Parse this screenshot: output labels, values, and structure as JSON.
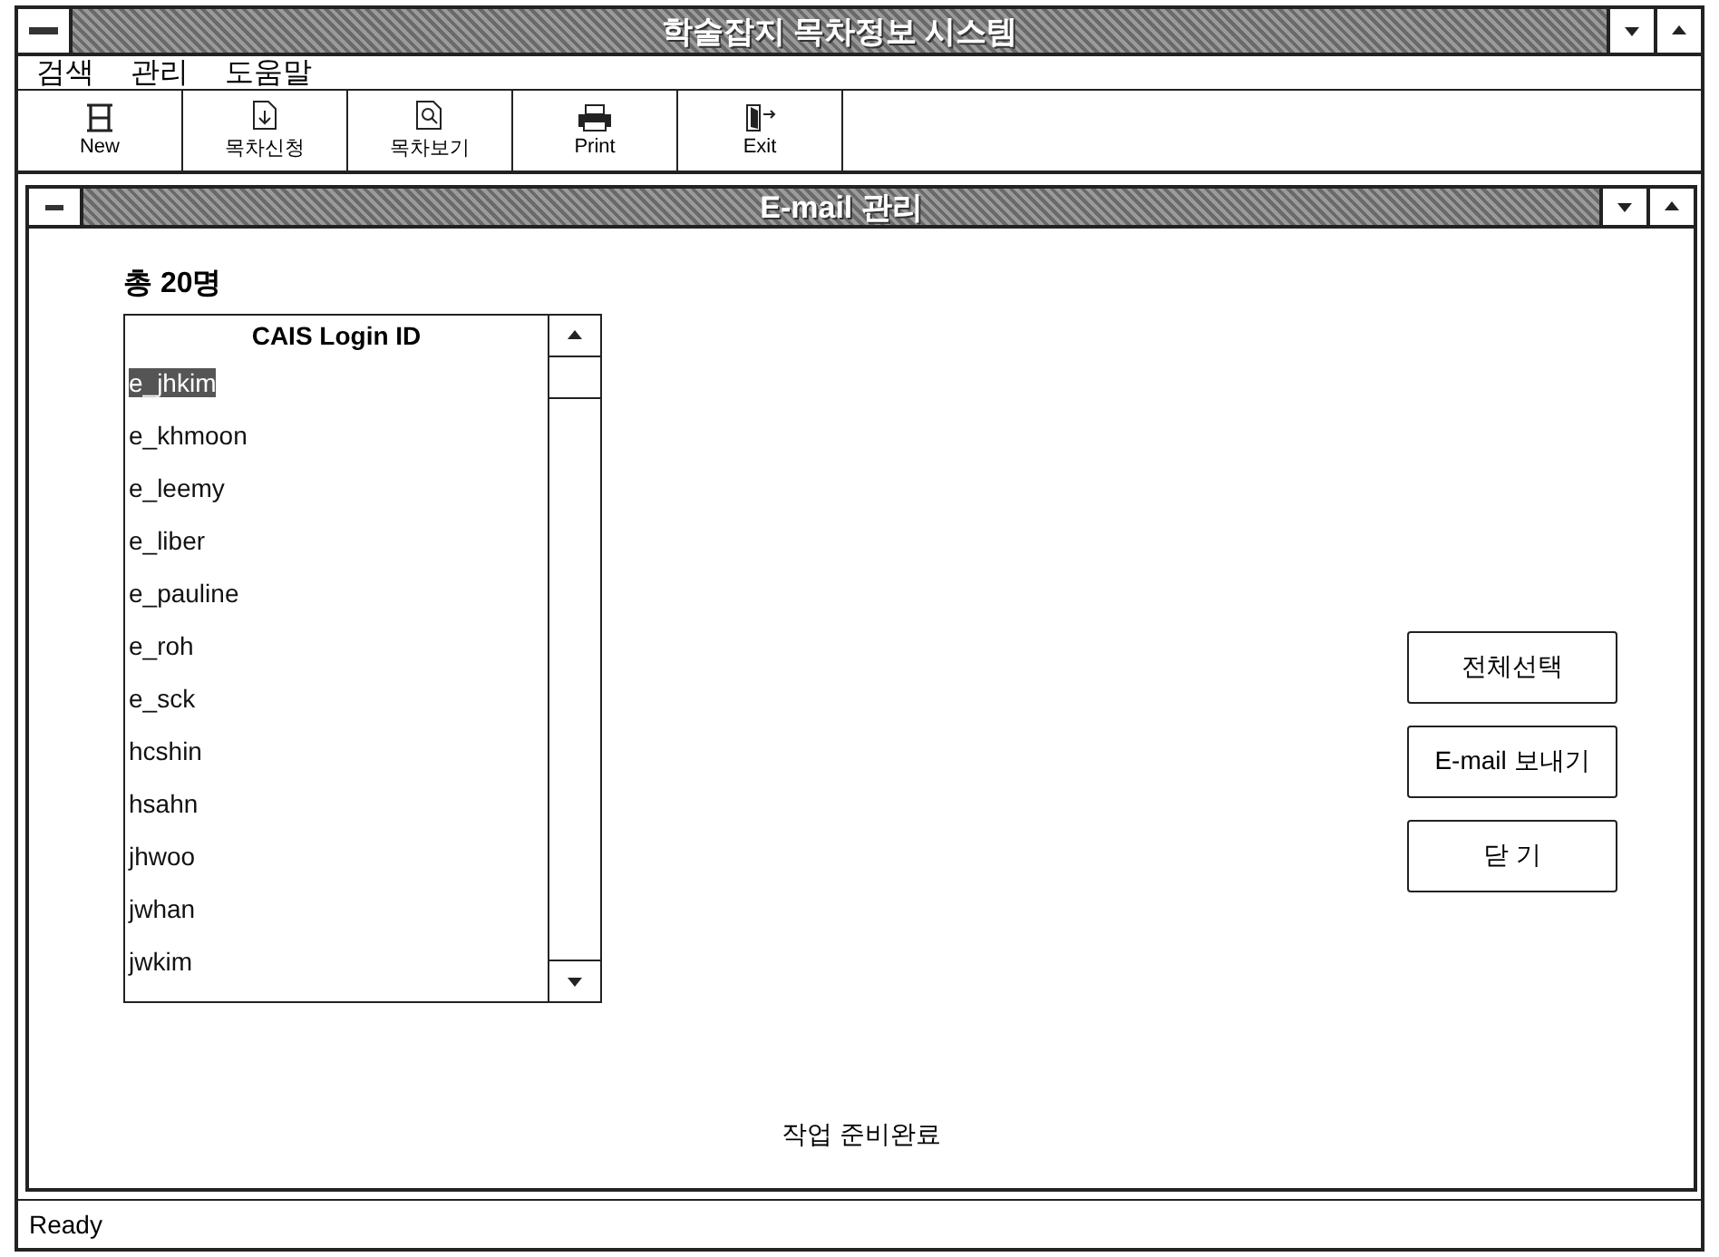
{
  "window": {
    "title": "학술잡지 목차정보 시스템"
  },
  "menu": [
    "검색",
    "관리",
    "도움말"
  ],
  "toolbar": [
    {
      "label": "New",
      "kind": "new"
    },
    {
      "label": "목차신청",
      "kind": "request"
    },
    {
      "label": "목차보기",
      "kind": "view"
    },
    {
      "label": "Print",
      "kind": "print"
    },
    {
      "label": "Exit",
      "kind": "exit"
    }
  ],
  "child_window": {
    "title": "E-mail 관리",
    "count": "총 20명",
    "list": {
      "header": "CAIS Login ID",
      "items": [
        {
          "text": "e_jhkim",
          "selected": true
        },
        {
          "text": "e_khmoon",
          "selected": false
        },
        {
          "text": "e_leemy",
          "selected": false
        },
        {
          "text": "e_liber",
          "selected": false
        },
        {
          "text": "e_pauline",
          "selected": false
        },
        {
          "text": "e_roh",
          "selected": false
        },
        {
          "text": "e_sck",
          "selected": false
        },
        {
          "text": "hcshin",
          "selected": false
        },
        {
          "text": "hsahn",
          "selected": false
        },
        {
          "text": "jhwoo",
          "selected": false
        },
        {
          "text": "jwhan",
          "selected": false
        },
        {
          "text": "jwkim",
          "selected": false
        }
      ]
    },
    "buttons": [
      "전체선택",
      "E-mail 보내기",
      "닫 기"
    ],
    "message": "작업 준비완료"
  },
  "status_bar": "Ready"
}
